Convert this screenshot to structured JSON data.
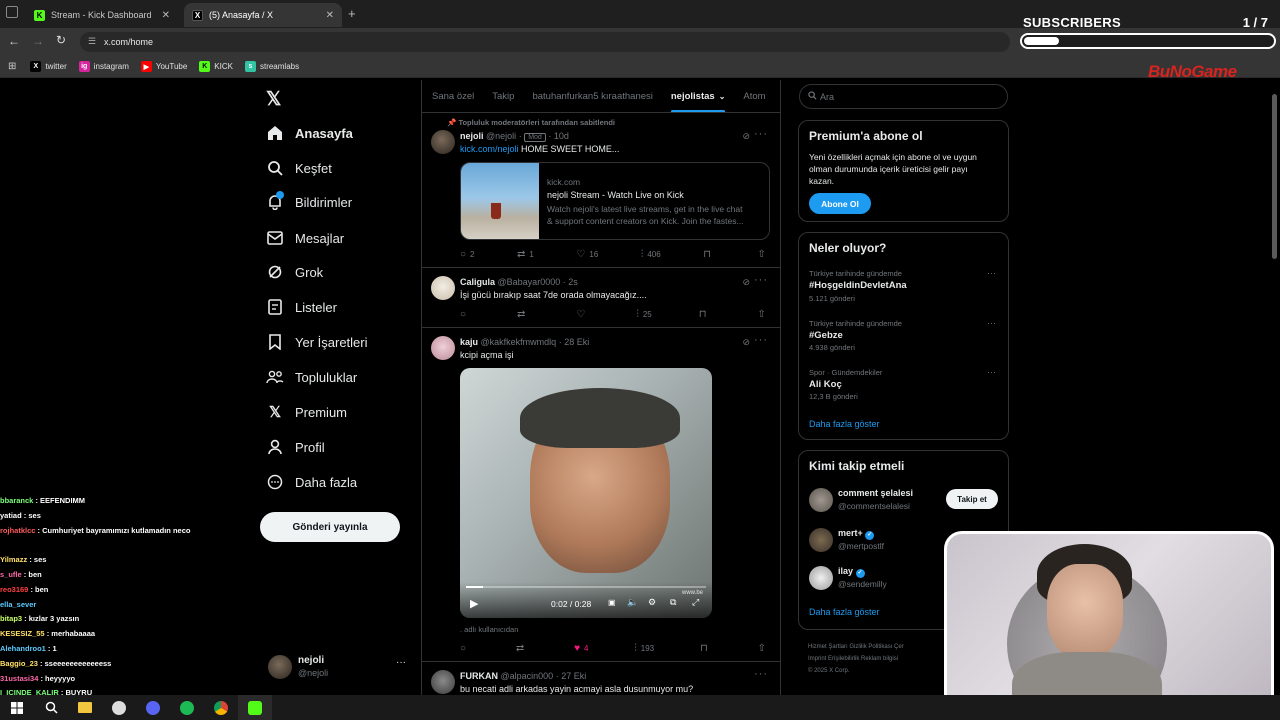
{
  "browser": {
    "tabs": [
      {
        "title": "Stream - Kick Dashboard",
        "favicon": "K"
      },
      {
        "title": "(5) Anasayfa / X",
        "favicon": "X"
      }
    ],
    "url": "x.com/home",
    "bookmarks": [
      {
        "label": "twitter",
        "icon": "X"
      },
      {
        "label": "instagram",
        "icon": "ig"
      },
      {
        "label": "YouTube",
        "icon": "▶"
      },
      {
        "label": "KICK",
        "icon": "K"
      },
      {
        "label": "streamlabs",
        "icon": "s"
      }
    ]
  },
  "overlay": {
    "subscribers_label": "SUBSCRIBERS",
    "subscribers_count": "1 / 7",
    "subscribers_progress": 0.143,
    "watermark": "BuNoGame"
  },
  "x": {
    "nav": [
      {
        "label": "Anasayfa",
        "icon": "home-icon",
        "active": true
      },
      {
        "label": "Keşfet",
        "icon": "search-icon"
      },
      {
        "label": "Bildirimler",
        "icon": "bell-icon"
      },
      {
        "label": "Mesajlar",
        "icon": "mail-icon"
      },
      {
        "label": "Grok",
        "icon": "grok-icon"
      },
      {
        "label": "Listeler",
        "icon": "list-icon"
      },
      {
        "label": "Yer İşaretleri",
        "icon": "bookmark-icon"
      },
      {
        "label": "Topluluklar",
        "icon": "community-icon"
      },
      {
        "label": "Premium",
        "icon": "x-logo-icon"
      },
      {
        "label": "Profil",
        "icon": "profile-icon"
      },
      {
        "label": "Daha fazla",
        "icon": "more-icon"
      }
    ],
    "post_button": "Gönderi yayınla",
    "account": {
      "name": "nejoli",
      "handle": "@nejoli"
    },
    "timeline_tabs": [
      {
        "label": "Sana özel"
      },
      {
        "label": "Takip"
      },
      {
        "label": "batuhanfurkan5 kıraathanesi"
      },
      {
        "label": "nejolistas",
        "active": true
      },
      {
        "label": "Atom"
      }
    ],
    "tweets": [
      {
        "pinned": "Topluluk moderatörleri tarafından sabitlendi",
        "name": "nejoli",
        "handle": "@nejoli",
        "badge": "Mod",
        "time": "10d",
        "link": "kick.com/nejoli",
        "text": " HOME SWEET HOME...",
        "card": {
          "domain": "kick.com",
          "title": "nejoli Stream - Watch Live on Kick",
          "desc1": "Watch nejoli's latest live streams, get in the live chat",
          "desc2": "& support content creators on Kick. Join the fastes..."
        },
        "replies": "2",
        "reposts": "1",
        "likes": "16",
        "views": "406"
      },
      {
        "name": "Caligula",
        "handle": "@Babayar0000",
        "time": "2s",
        "text": "İşi gücü bırakıp saat 7de orada olmayacağız....",
        "replies": "",
        "reposts": "",
        "likes": "",
        "views": "25"
      },
      {
        "name": "kaju",
        "handle": "@kakfkekfmwmdlq",
        "time": "28 Eki",
        "text": "kcipi açma işi",
        "video_time": "0:02 / 0:28",
        "video_watermark": "www.be",
        "edit_note": ". adlı kullanıcıdan",
        "replies": "",
        "reposts": "",
        "likes": "4",
        "views": "193"
      },
      {
        "name": "FURKAN",
        "handle": "@alpacin000",
        "time": "27 Eki",
        "text": "bu necati adli arkadas yayin acmayi asla dusunmuyor mu?"
      }
    ],
    "search_placeholder": "Ara",
    "premium": {
      "title": "Premium'a abone ol",
      "line1": "Yeni özellikleri açmak için abone ol ve uygun",
      "line2": "olman durumunda içerik üreticisi gelir payı",
      "line3": "kazan.",
      "button": "Abone Ol"
    },
    "trends_title": "Neler oluyor?",
    "trends": [
      {
        "meta": "Türkiye tarihinde gündemde",
        "name": "#HoşgeldinDevletAna",
        "count": "5.121 gönderi"
      },
      {
        "meta": "Türkiye tarihinde gündemde",
        "name": "#Gebze",
        "count": "4.938 gönderi"
      },
      {
        "meta": "Spor · Gündemdekiler",
        "name": "Ali Koç",
        "count": "12,3 B gönderi"
      }
    ],
    "trends_more": "Daha fazla göster",
    "follow_title": "Kimi takip etmeli",
    "follow": [
      {
        "name": "comment şelalesi",
        "handle": "@commentselalesi",
        "button": "Takip et"
      },
      {
        "name": "mert+",
        "handle": "@mertpostlf"
      },
      {
        "name": "ilay",
        "handle": "@sendemilly"
      }
    ],
    "follow_more": "Daha fazla göster",
    "footer": [
      {
        "a": "Hizmet Şartları",
        "b": "Gizlilik Politikası",
        "c": "Çer"
      },
      {
        "a": "Imprint",
        "b": "Erişilebilirlik",
        "c": "Reklam bilgisi"
      },
      {
        "a": "© 2025 X Corp.",
        "b": "",
        "c": ""
      }
    ]
  },
  "chat": [
    {
      "user": "bbaranck",
      "msg": "EEFENDIMM",
      "color": "#7cff7c"
    },
    {
      "user": "yatiad",
      "msg": "ses",
      "color": "#ffffff"
    },
    {
      "user": "rojhatklcc",
      "msg": "Cumhuriyet bayramımızı kutlamadın neco",
      "color": "#ff5a5a"
    },
    {
      "user": "",
      "msg": "",
      "color": "#ffffff"
    },
    {
      "user": "Yilmazz",
      "msg": "ses",
      "color": "#ffe066"
    },
    {
      "user": "s_ufle",
      "msg": "ben",
      "color": "#ff6aa8"
    },
    {
      "user": "reo3169",
      "msg": "ben",
      "color": "#ff4040"
    },
    {
      "user": "ella_sever",
      "msg": "",
      "color": "#5ecbff"
    },
    {
      "user": "bitap3",
      "msg": "kızlar 3 yazsın",
      "color": "#c6ff66"
    },
    {
      "user": "KESESIZ_55",
      "msg": "merhabaaaa",
      "color": "#ffe066"
    },
    {
      "user": "Alehandroo1",
      "msg": "1",
      "color": "#5ecbff"
    },
    {
      "user": "Baggio_23",
      "msg": "sseeeeeeeeeeeess",
      "color": "#ffe066"
    },
    {
      "user": "31ustasi34",
      "msg": "heyyyyo",
      "color": "#ff6aa8"
    },
    {
      "user": "I_ICINDE_KALIR",
      "msg": "BUYRU",
      "color": "#7cff7c"
    }
  ]
}
